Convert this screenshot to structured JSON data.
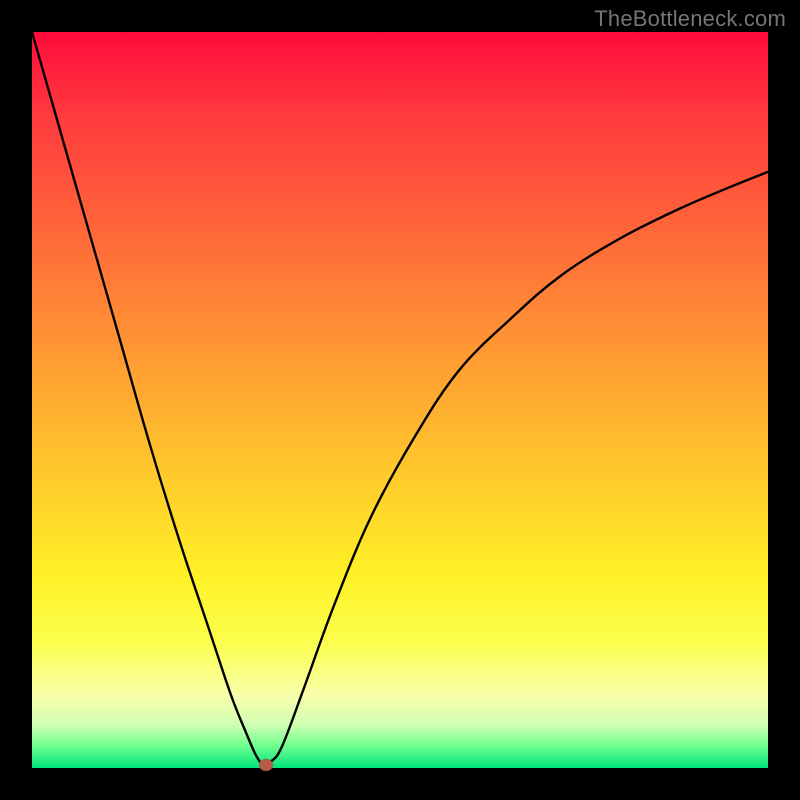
{
  "watermark": "TheBottleneck.com",
  "chart_data": {
    "type": "line",
    "title": "",
    "xlabel": "",
    "ylabel": "",
    "xlim": [
      0,
      100
    ],
    "ylim": [
      0,
      100
    ],
    "grid": false,
    "background_gradient": {
      "direction": "top-to-bottom",
      "stops": [
        {
          "color": "#ff0b3a",
          "pos": 0
        },
        {
          "color": "#ff6a39",
          "pos": 28
        },
        {
          "color": "#ffc92c",
          "pos": 60
        },
        {
          "color": "#fff126",
          "pos": 74
        },
        {
          "color": "#f8ffa8",
          "pos": 90
        },
        {
          "color": "#00e37a",
          "pos": 100
        }
      ]
    },
    "series": [
      {
        "name": "bottleneck-curve",
        "color": "#000000",
        "x": [
          0,
          4,
          8,
          12,
          16,
          20,
          24,
          27,
          29,
          30.5,
          31.5,
          32.5,
          34,
          37,
          41,
          46,
          52,
          58,
          65,
          72,
          80,
          88,
          95,
          100
        ],
        "y": [
          100,
          86,
          72,
          58,
          44,
          31,
          19,
          10,
          5,
          1.6,
          0.5,
          0.9,
          3,
          11,
          22,
          34,
          45,
          54,
          61,
          67,
          72,
          76,
          79,
          81
        ]
      }
    ],
    "minimum_marker": {
      "x": 31.8,
      "y": 0.4,
      "color": "#b85a4a"
    }
  }
}
